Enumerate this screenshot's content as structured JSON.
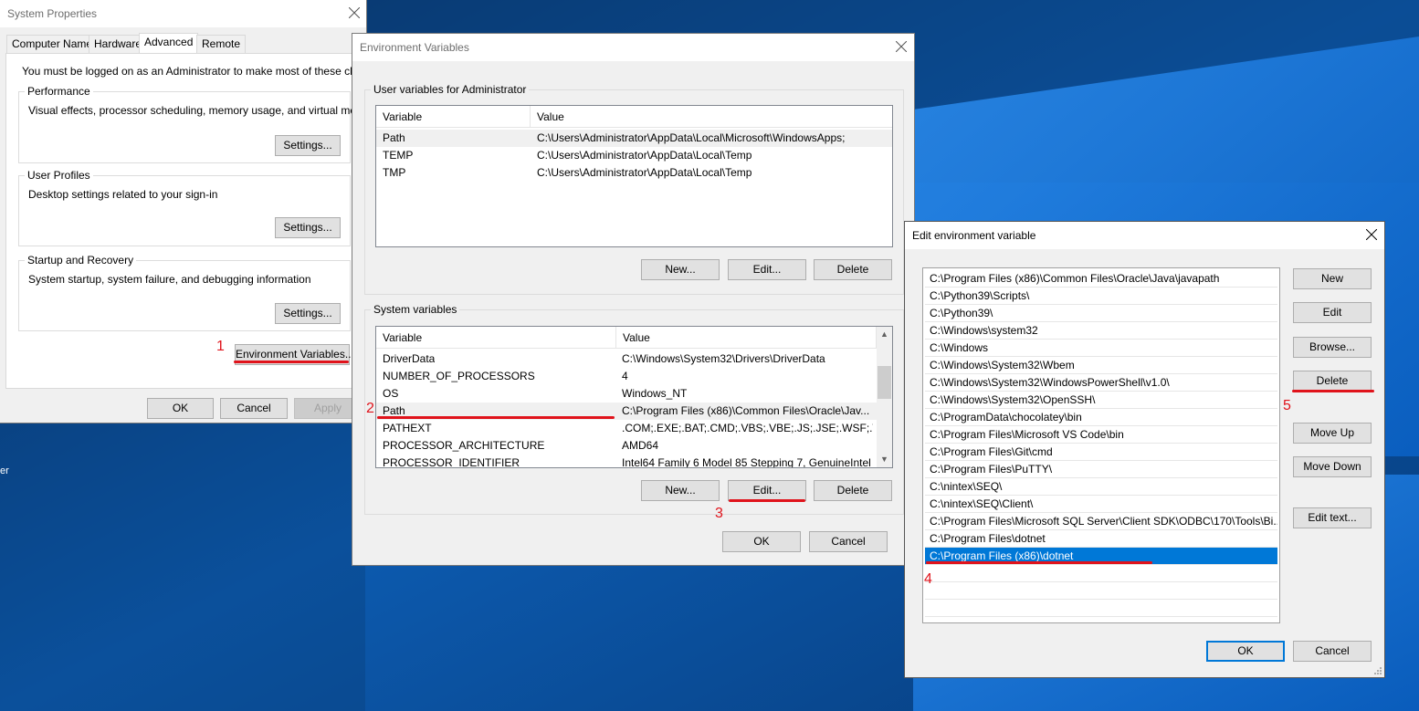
{
  "desktop": {
    "edge_text": "er"
  },
  "system_properties": {
    "title": "System Properties",
    "tabs": [
      {
        "label": "Computer Name"
      },
      {
        "label": "Hardware"
      },
      {
        "label": "Advanced"
      },
      {
        "label": "Remote"
      }
    ],
    "active_tab": "Advanced",
    "notice": "You must be logged on as an Administrator to make most of these changes.",
    "performance": {
      "legend": "Performance",
      "description": "Visual effects, processor scheduling, memory usage, and virtual memory",
      "button": "Settings..."
    },
    "user_profiles": {
      "legend": "User Profiles",
      "description": "Desktop settings related to your sign-in",
      "button": "Settings..."
    },
    "startup_recovery": {
      "legend": "Startup and Recovery",
      "description": "System startup, system failure, and debugging information",
      "button": "Settings..."
    },
    "env_button": "Environment Variables...",
    "ok": "OK",
    "cancel": "Cancel",
    "apply": "Apply"
  },
  "env_vars": {
    "title": "Environment Variables",
    "user_group": "User variables for Administrator",
    "user_columns": {
      "variable": "Variable",
      "value": "Value"
    },
    "user_rows": [
      {
        "variable": "Path",
        "value": "C:\\Users\\Administrator\\AppData\\Local\\Microsoft\\WindowsApps;"
      },
      {
        "variable": "TEMP",
        "value": "C:\\Users\\Administrator\\AppData\\Local\\Temp"
      },
      {
        "variable": "TMP",
        "value": "C:\\Users\\Administrator\\AppData\\Local\\Temp"
      }
    ],
    "user_buttons": {
      "new": "New...",
      "edit": "Edit...",
      "delete": "Delete"
    },
    "system_group": "System variables",
    "system_columns": {
      "variable": "Variable",
      "value": "Value"
    },
    "system_rows": [
      {
        "variable": "DriverData",
        "value": "C:\\Windows\\System32\\Drivers\\DriverData"
      },
      {
        "variable": "NUMBER_OF_PROCESSORS",
        "value": "4"
      },
      {
        "variable": "OS",
        "value": "Windows_NT"
      },
      {
        "variable": "Path",
        "value": "C:\\Program Files (x86)\\Common Files\\Oracle\\Jav..."
      },
      {
        "variable": "PATHEXT",
        "value": ".COM;.EXE;.BAT;.CMD;.VBS;.VBE;.JS;.JSE;.WSF;.WS..."
      },
      {
        "variable": "PROCESSOR_ARCHITECTURE",
        "value": "AMD64"
      },
      {
        "variable": "PROCESSOR_IDENTIFIER",
        "value": "Intel64 Family 6 Model 85 Stepping 7, GenuineIntel"
      }
    ],
    "selected_system_row": "Path",
    "system_buttons": {
      "new": "New...",
      "edit": "Edit...",
      "delete": "Delete"
    },
    "ok": "OK",
    "cancel": "Cancel"
  },
  "edit_env": {
    "title": "Edit environment variable",
    "entries": [
      "C:\\Program Files (x86)\\Common Files\\Oracle\\Java\\javapath",
      "C:\\Python39\\Scripts\\",
      "C:\\Python39\\",
      "C:\\Windows\\system32",
      "C:\\Windows",
      "C:\\Windows\\System32\\Wbem",
      "C:\\Windows\\System32\\WindowsPowerShell\\v1.0\\",
      "C:\\Windows\\System32\\OpenSSH\\",
      "C:\\ProgramData\\chocolatey\\bin",
      "C:\\Program Files\\Microsoft VS Code\\bin",
      "C:\\Program Files\\Git\\cmd",
      "C:\\Program Files\\PuTTY\\",
      "C:\\nintex\\SEQ\\",
      "C:\\nintex\\SEQ\\Client\\",
      "C:\\Program Files\\Microsoft SQL Server\\Client SDK\\ODBC\\170\\Tools\\Bi...",
      "C:\\Program Files\\dotnet",
      "C:\\Program Files (x86)\\dotnet"
    ],
    "selected_entry": "C:\\Program Files (x86)\\dotnet",
    "buttons": {
      "new": "New",
      "edit": "Edit",
      "browse": "Browse...",
      "delete": "Delete",
      "move_up": "Move Up",
      "move_down": "Move Down",
      "edit_text": "Edit text..."
    },
    "ok": "OK",
    "cancel": "Cancel"
  },
  "annotations": {
    "color": "#e0131b",
    "steps": [
      "1",
      "2",
      "3",
      "4",
      "5"
    ]
  },
  "colors": {
    "selection": "#0078d7",
    "desktop": "#0b4a8f"
  }
}
